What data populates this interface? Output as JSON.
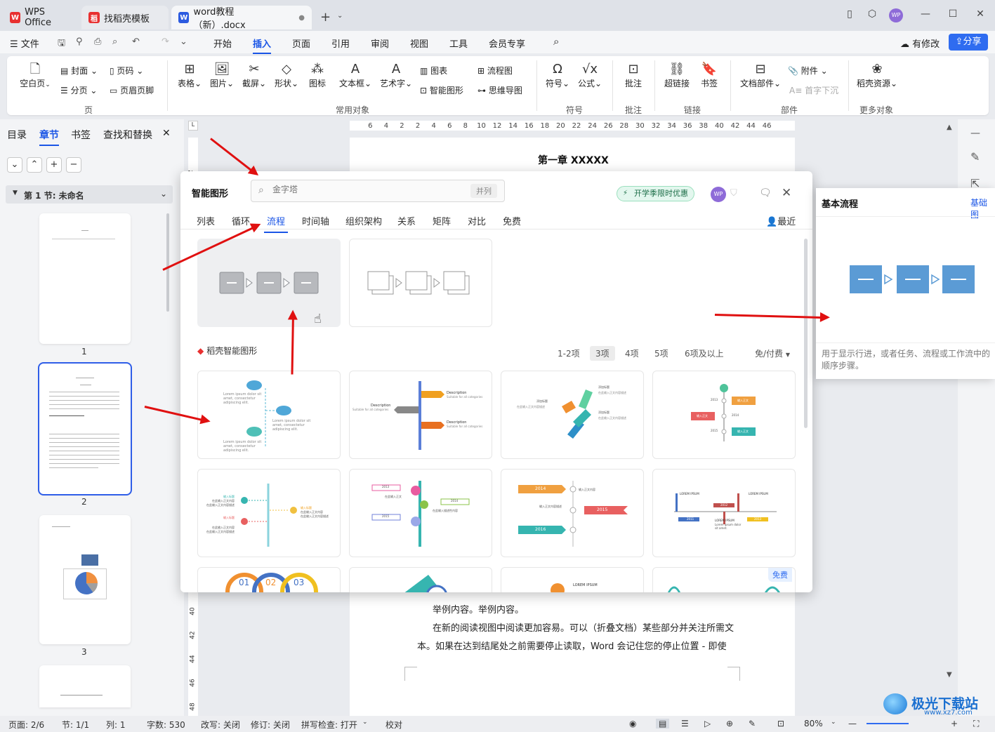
{
  "tabs": [
    {
      "label": "WPS Office"
    },
    {
      "label": "找稻壳模板"
    },
    {
      "label": "word教程（新）.docx"
    }
  ],
  "menu": {
    "file": "文件",
    "items": [
      "开始",
      "插入",
      "页面",
      "引用",
      "审阅",
      "视图",
      "工具",
      "会员专享"
    ],
    "modified": "有修改",
    "share": "分享"
  },
  "ribbon": {
    "items": [
      "空白页",
      "封面",
      "页码",
      "分页",
      "页眉页脚",
      "表格",
      "图片",
      "截屏",
      "形状",
      "图标",
      "文本框",
      "艺术字",
      "图表",
      "智能图形",
      "流程图",
      "思维导图",
      "符号",
      "公式",
      "批注",
      "超链接",
      "书签",
      "附件",
      "文档部件",
      "首字下沉",
      "稻壳资源"
    ],
    "groups": [
      "页",
      "常用对象",
      "符号",
      "批注",
      "链接",
      "部件",
      "更多对象"
    ]
  },
  "left": {
    "tabs": [
      "目录",
      "章节",
      "书签",
      "查找和替换"
    ],
    "section": "第 1 节: 未命名",
    "pages": [
      "1",
      "2",
      "3"
    ]
  },
  "ruler": [
    "6",
    "4",
    "2",
    "2",
    "4",
    "6",
    "8",
    "10",
    "12",
    "14",
    "16",
    "18",
    "20",
    "22",
    "24",
    "26",
    "28",
    "30",
    "32",
    "34",
    "36",
    "38",
    "40",
    "42",
    "44",
    "46"
  ],
  "vruler": [
    "2",
    "40",
    "42",
    "44",
    "46",
    "48"
  ],
  "doc": {
    "heading": "第一章 XXXXX",
    "p1": "举例内容。举例内容。",
    "p2": "在新的阅读视图中阅读更加容易。可以（折叠文档）某些部分并关注所需文",
    "p3": "本。如果在达到结尾处之前需要停止读取，Word 会记住您的停止位置 - 即使"
  },
  "dialog": {
    "title": "智能图形",
    "search_placeholder": "金字塔",
    "search_hint": "并列",
    "promo": "开学季限时优惠",
    "avatar": "WP",
    "tabs": [
      "列表",
      "循环",
      "流程",
      "时间轴",
      "组织架构",
      "关系",
      "矩阵",
      "对比",
      "免费"
    ],
    "recent": "最近",
    "section": "稻壳智能图形",
    "filters": [
      "1-2项",
      "3项",
      "4项",
      "5项",
      "6项及以上"
    ],
    "price": "免/付费",
    "free_badge": "免费"
  },
  "cards": {
    "c1": [
      "Lorem ipsum dolor sit amet, consectetur adipiscing elit.",
      "Lorem ipsum dolor sit amet, consectetur adipiscing elit.",
      "Lorem ipsum dolor sit amet, consectetur adipiscing elit."
    ],
    "c2": [
      "Description",
      "Suitable for all categories",
      "Description",
      "Suitable for all categories",
      "Description",
      "Suitable for all categories"
    ],
    "c3": [
      "添加标题",
      "在此输入正文内容描述",
      "添加标题",
      "在此输入正文内容描述",
      "添加标题",
      "在此输入正文内容描述"
    ],
    "c4": [
      "2013",
      "输入正文",
      "输入正文",
      "2014",
      "2015",
      "输入正文"
    ],
    "c5": [
      "输入标题",
      "在此输入正文内容",
      "在此输入正文内容描述",
      "输入标题",
      "在此输入正文内容",
      "在此输入正文内容描述",
      "输入标题",
      "在此输入正文内容",
      "在此输入正文内容描述"
    ],
    "c6": [
      "2013",
      "2014",
      "2015",
      "在此输入正文",
      "在此输入描述性内容"
    ],
    "c7": [
      "2014",
      "2015",
      "2016",
      "输入正文内容",
      "输入正文内容描述"
    ],
    "c8": [
      "LOREM IPSUM",
      "LOREM IPSUM",
      "LOREM IPSUM",
      "Lorem ipsum dolor sit amet.",
      "2011",
      "2012",
      "2013",
      "2014"
    ],
    "c9": [
      "01",
      "02",
      "03"
    ],
    "c11": [
      "LOREM IPSUM"
    ]
  },
  "preview": {
    "title": "基本流程",
    "link": "基础图",
    "desc": "用于显示行进，或者任务、流程或工作流中的顺序步骤。"
  },
  "status": {
    "page": "页面: 2/6",
    "section": "节: 1/1",
    "col": "列: 1",
    "words": "字数: 530",
    "revise": "改写: 关闭",
    "track": "修订: 关闭",
    "spell": "拼写检查: 打开",
    "proof": "校对",
    "zoom": "80%"
  },
  "watermark": {
    "name": "极光下载站",
    "url": "www.xz7.com"
  },
  "colors": {
    "accent": "#1a55e6",
    "arrow": "#e01010",
    "shape": "#5b9bd5"
  }
}
